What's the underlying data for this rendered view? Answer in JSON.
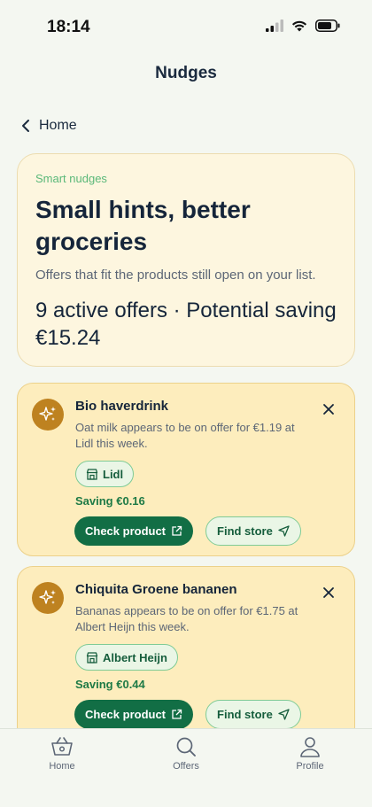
{
  "status": {
    "time": "18:14"
  },
  "nav": {
    "title": "Nudges",
    "back_label": "Home"
  },
  "hero": {
    "eyebrow": "Smart nudges",
    "title": "Small hints, better groceries",
    "subtitle": "Offers that fit the products still open on your list.",
    "stats": "9 active offers · Potential saving €15.24"
  },
  "nudges": [
    {
      "title": "Bio haverdrink",
      "description": "Oat milk appears to be on offer for €1.19 at Lidl this week.",
      "store": "Lidl",
      "saving": "Saving €0.16",
      "check_label": "Check product",
      "find_label": "Find store"
    },
    {
      "title": "Chiquita Groene bananen",
      "description": "Bananas appears to be on offer for €1.75 at Albert Heijn this week.",
      "store": "Albert Heijn",
      "saving": "Saving €0.44",
      "check_label": "Check product",
      "find_label": "Find store"
    }
  ],
  "tabs": [
    {
      "label": "Home",
      "icon": "basket-icon"
    },
    {
      "label": "Offers",
      "icon": "search-icon"
    },
    {
      "label": "Profile",
      "icon": "person-icon"
    }
  ],
  "colors": {
    "background": "#f4f7f1",
    "hero_bg": "#fdf6df",
    "nudge_bg": "#fdedbd",
    "primary_green": "#126e45",
    "accent_green": "#5ab879",
    "icon_gold": "#be8220"
  }
}
